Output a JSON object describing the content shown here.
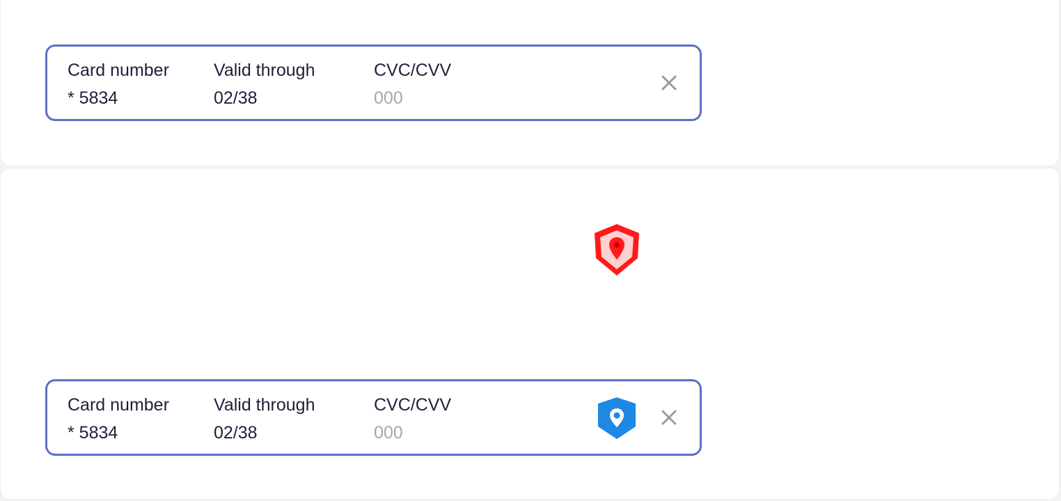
{
  "top_card": {
    "card_number_label": "Card number",
    "card_number_value": "* 5834",
    "valid_through_label": "Valid through",
    "valid_through_value": "02/38",
    "cvc_label": "CVC/CVV",
    "cvc_placeholder": "000",
    "close_icon": "close-icon"
  },
  "bottom_card": {
    "card_number_label": "Card number",
    "card_number_value": "* 5834",
    "valid_through_label": "Valid through",
    "valid_through_value": "02/38",
    "cvc_label": "CVC/CVV",
    "cvc_placeholder": "000",
    "badge_icon": "location-shield-icon",
    "close_icon": "close-icon"
  },
  "floating_icon": "location-shield-icon",
  "colors": {
    "border": "#5b6fc8",
    "text": "#1f1f3a",
    "placeholder": "#a6a7b3",
    "close": "#9a9aa5",
    "shield_red": "#ff1a1a",
    "shield_blue": "#1e88e5"
  }
}
